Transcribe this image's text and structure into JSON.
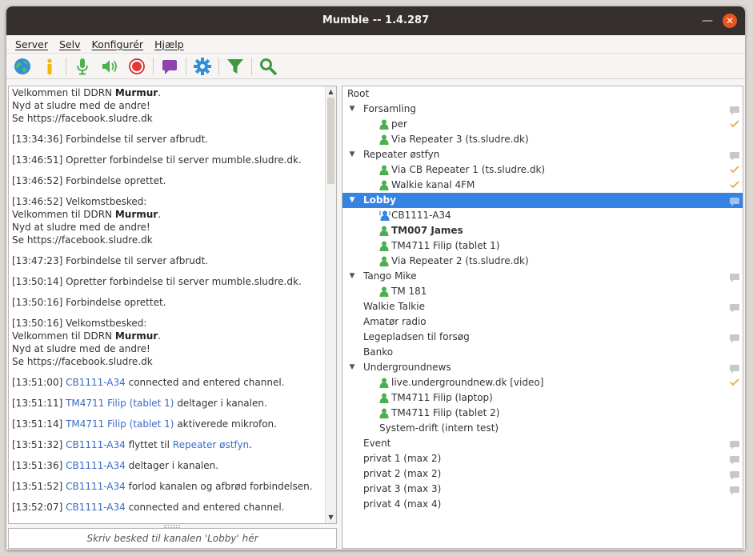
{
  "window": {
    "title": "Mumble -- 1.4.287"
  },
  "menu": [
    "Server",
    "Selv",
    "Konfigurér",
    "Hjælp"
  ],
  "toolbar": {
    "icons": [
      "globe-icon",
      "info-icon",
      "microphone-icon",
      "speaker-icon",
      "record-icon",
      "chat-bubble-icon",
      "gear-icon",
      "filter-icon",
      "search-icon"
    ]
  },
  "log": [
    {
      "time": "",
      "text": "Velkommen til DDRN ",
      "bold": "Murmur",
      "after": ".",
      "lines": [
        "Nyd at sludre med de andre!",
        "Se https://facebook.sludre.dk"
      ]
    },
    {
      "time": "[13:34:36]",
      "text": " Forbindelse til server afbrudt."
    },
    {
      "time": "[13:46:51]",
      "text": " Opretter forbindelse til server mumble.sludre.dk."
    },
    {
      "time": "[13:46:52]",
      "text": " Forbindelse oprettet."
    },
    {
      "time": "[13:46:52]",
      "text": " Velkomstbesked:",
      "lines_pre": [
        "Velkommen til DDRN "
      ],
      "bold": "Murmur",
      "after": ".",
      "lines": [
        "Nyd at sludre med de andre!",
        "Se https://facebook.sludre.dk"
      ]
    },
    {
      "time": "[13:47:23]",
      "text": " Forbindelse til server afbrudt."
    },
    {
      "time": "[13:50:14]",
      "text": " Opretter forbindelse til server mumble.sludre.dk."
    },
    {
      "time": "[13:50:16]",
      "text": " Forbindelse oprettet."
    },
    {
      "time": "[13:50:16]",
      "text": " Velkomstbesked:",
      "lines_pre": [
        "Velkommen til DDRN "
      ],
      "bold": "Murmur",
      "after": ".",
      "lines": [
        "Nyd at sludre med de andre!",
        "Se https://facebook.sludre.dk"
      ]
    },
    {
      "time": "[13:51:00]",
      "link": "CB1111-A34",
      "text": " connected and entered channel."
    },
    {
      "time": "[13:51:11]",
      "link": "TM4711 Filip (tablet 1)",
      "text": " deltager i kanalen."
    },
    {
      "time": "[13:51:14]",
      "link": "TM4711 Filip (tablet 1)",
      "text": " aktiverede mikrofon."
    },
    {
      "time": "[13:51:32]",
      "link": "CB1111-A34",
      "text": " flyttet til ",
      "link2": "Repeater østfyn",
      "after": "."
    },
    {
      "time": "[13:51:36]",
      "link": "CB1111-A34",
      "text": " deltager i kanalen."
    },
    {
      "time": "[13:51:52]",
      "link": "CB1111-A34",
      "text": " forlod kanalen og afbrød forbindelsen."
    },
    {
      "time": "[13:52:07]",
      "link": "CB1111-A34",
      "text": " connected and entered channel."
    }
  ],
  "chat_input": {
    "placeholder": "Skriv besked til kanalen 'Lobby' hér"
  },
  "tree": [
    {
      "type": "root",
      "label": "Root",
      "depth": 0
    },
    {
      "type": "channel",
      "label": "Forsamling",
      "depth": 1,
      "expanded": true,
      "comment": true
    },
    {
      "type": "user",
      "label": "per",
      "depth": 2,
      "check": true
    },
    {
      "type": "user",
      "label": "Via Repeater 3 (ts.sludre.dk)",
      "depth": 2
    },
    {
      "type": "channel",
      "label": "Repeater østfyn",
      "depth": 1,
      "expanded": true,
      "comment": true
    },
    {
      "type": "user",
      "label": "Via CB Repeater 1 (ts.sludre.dk)",
      "depth": 2,
      "check": true
    },
    {
      "type": "user",
      "label": "Walkie kanal 4FM",
      "depth": 2,
      "check": true
    },
    {
      "type": "channel",
      "label": "Lobby",
      "depth": 1,
      "expanded": true,
      "comment": true,
      "selected": true
    },
    {
      "type": "user",
      "label": "CB1111-A34",
      "depth": 2,
      "talking": true
    },
    {
      "type": "user",
      "label": "TM007 James",
      "depth": 2,
      "bold": true
    },
    {
      "type": "user",
      "label": "TM4711 Filip (tablet 1)",
      "depth": 2
    },
    {
      "type": "user",
      "label": "Via Repeater 2 (ts.sludre.dk)",
      "depth": 2
    },
    {
      "type": "channel",
      "label": "Tango Mike",
      "depth": 1,
      "expanded": true,
      "comment": true
    },
    {
      "type": "user",
      "label": "TM 181",
      "depth": 2
    },
    {
      "type": "channel",
      "label": "Walkie Talkie",
      "depth": 1,
      "comment": true
    },
    {
      "type": "channel",
      "label": "Amatør radio",
      "depth": 1
    },
    {
      "type": "channel",
      "label": "Legepladsen til forsøg",
      "depth": 1,
      "comment": true
    },
    {
      "type": "channel",
      "label": "Banko",
      "depth": 1
    },
    {
      "type": "channel",
      "label": "Undergroundnews",
      "depth": 1,
      "expanded": true,
      "comment": true
    },
    {
      "type": "user",
      "label": "live.undergroundnew.dk [video]",
      "depth": 2,
      "check": true
    },
    {
      "type": "user",
      "label": "TM4711 Filip (laptop)",
      "depth": 2
    },
    {
      "type": "user",
      "label": "TM4711 Filip (tablet 2)",
      "depth": 2
    },
    {
      "type": "channel",
      "label": "System-drift (intern test)",
      "depth": 2
    },
    {
      "type": "channel",
      "label": "Event",
      "depth": 1,
      "comment": true
    },
    {
      "type": "channel",
      "label": "privat 1 (max 2)",
      "depth": 1,
      "comment": true
    },
    {
      "type": "channel",
      "label": "privat 2 (max 2)",
      "depth": 1,
      "comment": true
    },
    {
      "type": "channel",
      "label": "privat 3 (max 3)",
      "depth": 1,
      "comment": true
    },
    {
      "type": "channel",
      "label": "privat 4 (max 4)",
      "depth": 1
    }
  ],
  "colors": {
    "accent": "#3584e4",
    "link": "#3a6cc6",
    "user": "#4caf50",
    "talking": "#3584e4",
    "check": "#e8a33d"
  }
}
